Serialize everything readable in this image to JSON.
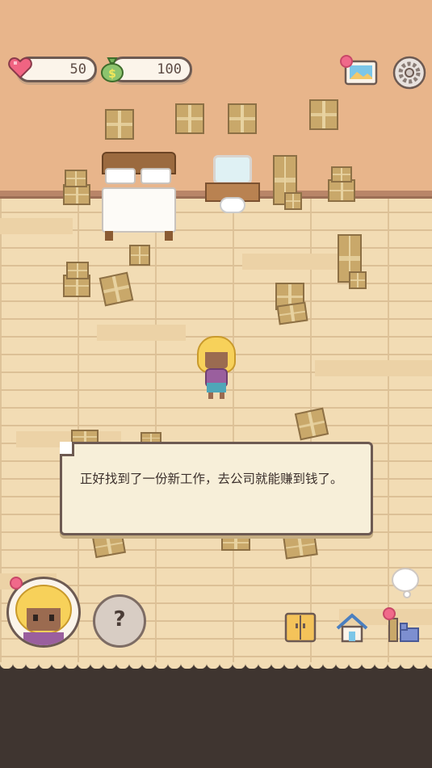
{
  "hud": {
    "health_value": "50",
    "money_value": "100"
  },
  "icons": {
    "health": "heart-icon",
    "money": "money-bag-icon",
    "album": "photo-album-icon",
    "settings": "gear-icon",
    "avatar": "character-portrait-icon",
    "help": "question-mark-icon",
    "wardrobe": "wardrobe-icon",
    "home": "house-icon",
    "furniture": "furniture-icon",
    "thought": "thought-bubble-icon"
  },
  "dialog": {
    "text": "正好找到了一份新工作，去公司就能赚到钱了。"
  },
  "help": {
    "label": "?"
  },
  "colors": {
    "wall": "#e8b58b",
    "floor": "#f2dcb4",
    "notification": "#f0698a",
    "outline": "#6d5a52"
  }
}
